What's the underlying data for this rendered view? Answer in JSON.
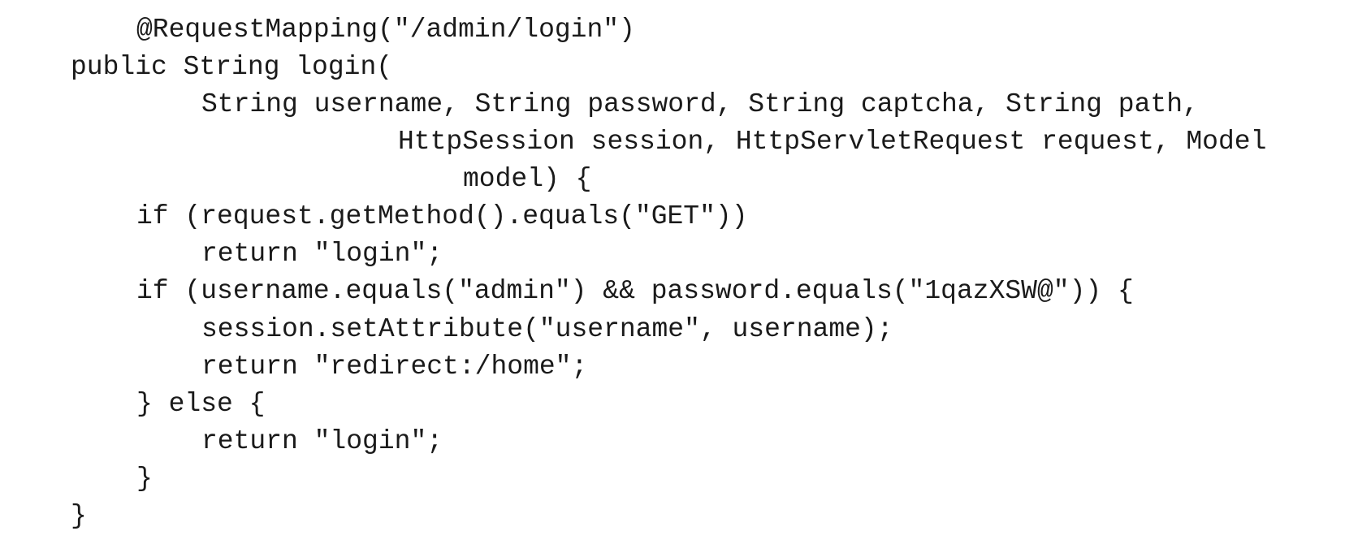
{
  "code": {
    "lines": [
      "@RequestMapping(\"/admin/login\")",
      "public String login(",
      "String username, String password, String captcha, String path,",
      "HttpSession session, HttpServletRequest request, Model",
      "model) {",
      "if (request.getMethod().equals(\"GET\"))",
      "return \"login\";",
      "if (username.equals(\"admin\") && password.equals(\"1qazXSW@\")) {",
      "session.setAttribute(\"username\", username);",
      "return \"redirect:/home\";",
      "} else {",
      "return \"login\";",
      "}",
      "}"
    ]
  }
}
